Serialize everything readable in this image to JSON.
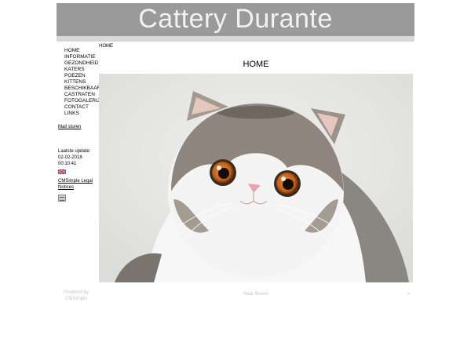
{
  "header": {
    "title": "Cattery Durante"
  },
  "nav": {
    "items": [
      {
        "label": "HOME"
      },
      {
        "label": "INFORMATIE"
      },
      {
        "label": "GEZONDHEID"
      },
      {
        "label": "KATERS"
      },
      {
        "label": "POEZEN"
      },
      {
        "label": "KITTENS"
      },
      {
        "label": "BESCHIKBAAR"
      },
      {
        "label": "CASTRATEN"
      },
      {
        "label": "FOTOGALERIJ"
      },
      {
        "label": "CONTACT"
      },
      {
        "label": "LINKS"
      }
    ]
  },
  "sidebar": {
    "mail_label": "Mail sturen",
    "update_label": "Laatste update:",
    "update_date": "02-02-2018",
    "update_time": "00:10:41",
    "legal_line1": "CMSimple Legal",
    "legal_line2": "Notices"
  },
  "main": {
    "breadcrumb": "HOME",
    "title": "HOME"
  },
  "footer": {
    "powered_line1": "Powered by",
    "powered_line2": "CMSimple",
    "top_link": "Naar Boven",
    "next_link": "»"
  },
  "colors": {
    "header_bg": "#9a9a9a",
    "header_text": "#f2f2f2",
    "footer_text": "#c6c6c6"
  }
}
